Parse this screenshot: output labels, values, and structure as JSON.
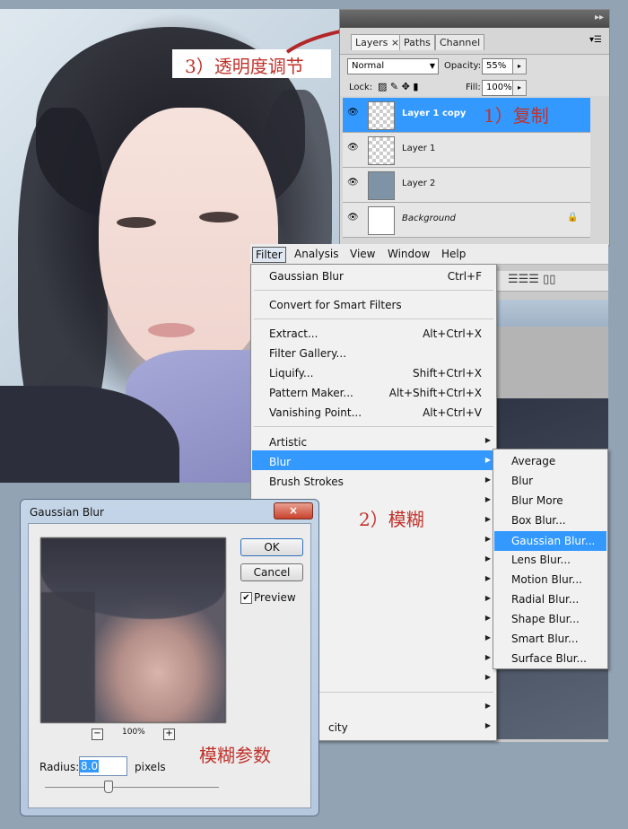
{
  "annotations": {
    "opacity_adjust": "3）透明度调节",
    "duplicate": "1）复制",
    "blur": "2）模糊",
    "blur_params": "模糊参数"
  },
  "layers_panel": {
    "tabs": [
      "Layers",
      "Paths",
      "Channel"
    ],
    "tab_close": "×",
    "blend_mode": "Normal",
    "opacity_label": "Opacity:",
    "opacity_value": "55%",
    "lock_label": "Lock:",
    "fill_label": "Fill:",
    "fill_value": "100%",
    "layers": [
      {
        "name": "Layer 1 copy",
        "selected": true
      },
      {
        "name": "Layer 1",
        "selected": false
      },
      {
        "name": "Layer 2",
        "selected": false
      },
      {
        "name": "Background",
        "selected": false
      }
    ]
  },
  "menubar": {
    "items": [
      "Filter",
      "Analysis",
      "View",
      "Window",
      "Help"
    ]
  },
  "filter_menu": {
    "last_filter": {
      "label": "Gaussian Blur",
      "shortcut": "Ctrl+F"
    },
    "convert": "Convert for Smart Filters",
    "items": [
      {
        "label": "Extract...",
        "shortcut": "Alt+Ctrl+X"
      },
      {
        "label": "Filter Gallery...",
        "shortcut": ""
      },
      {
        "label": "Liquify...",
        "shortcut": "Shift+Ctrl+X"
      },
      {
        "label": "Pattern Maker...",
        "shortcut": "Alt+Shift+Ctrl+X"
      },
      {
        "label": "Vanishing Point...",
        "shortcut": "Alt+Ctrl+V"
      }
    ],
    "categories": [
      "Artistic",
      "Blur",
      "Brush Strokes"
    ],
    "partial_item": "city"
  },
  "blur_submenu": [
    "Average",
    "Blur",
    "Blur More",
    "Box Blur...",
    "Gaussian Blur...",
    "Lens Blur...",
    "Motion Blur...",
    "Radial Blur...",
    "Shape Blur...",
    "Smart Blur...",
    "Surface Blur..."
  ],
  "gaussian_dialog": {
    "title": "Gaussian Blur",
    "close": "×",
    "ok": "OK",
    "cancel": "Cancel",
    "preview_label": "Preview",
    "preview_checked": true,
    "zoom": "100%",
    "zoom_out": "−",
    "zoom_in": "+",
    "radius_label": "Radius:",
    "radius_value": "8.0",
    "radius_unit": "pixels",
    "slider_fraction": 0.36
  }
}
